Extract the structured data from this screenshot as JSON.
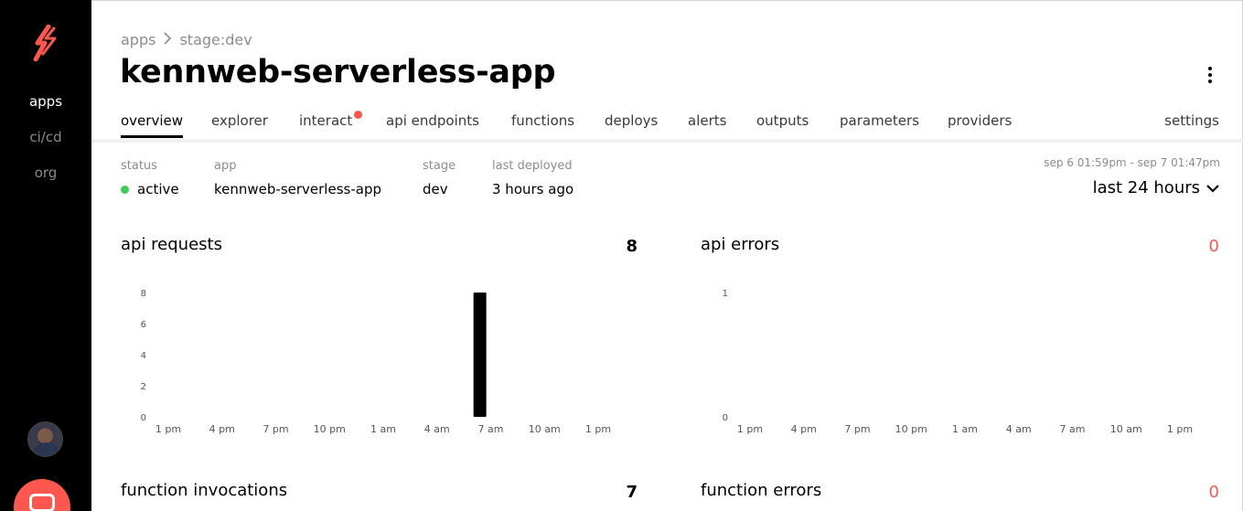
{
  "sidebar": {
    "items": [
      {
        "label": "apps",
        "active": true
      },
      {
        "label": "ci/cd",
        "active": false
      },
      {
        "label": "org",
        "active": false
      }
    ]
  },
  "breadcrumb": {
    "parent": "apps",
    "current": "stage:dev"
  },
  "title": "kennweb-serverless-app",
  "tabs": [
    {
      "label": "overview",
      "active": true
    },
    {
      "label": "explorer"
    },
    {
      "label": "interact",
      "badge": true
    },
    {
      "label": "api endpoints"
    },
    {
      "label": "functions"
    },
    {
      "label": "deploys"
    },
    {
      "label": "alerts"
    },
    {
      "label": "outputs"
    },
    {
      "label": "parameters"
    },
    {
      "label": "providers"
    },
    {
      "label": "settings"
    }
  ],
  "meta": {
    "status_label": "status",
    "status_value": "active",
    "app_label": "app",
    "app_value": "kennweb-serverless-app",
    "stage_label": "stage",
    "stage_value": "dev",
    "deployed_label": "last deployed",
    "deployed_value": "3 hours ago"
  },
  "time_range": {
    "label": "sep 6 01:59pm - sep 7 01:47pm",
    "selected": "last 24 hours"
  },
  "colors": {
    "accent": "#fd5750",
    "success": "#3ecb5b"
  },
  "cards": {
    "api_requests": {
      "title": "api requests",
      "total": "8"
    },
    "api_errors": {
      "title": "api errors",
      "total": "0"
    },
    "function_invocations": {
      "title": "function invocations",
      "total": "7"
    },
    "function_errors": {
      "title": "function errors",
      "total": "0"
    }
  },
  "chart_data": [
    {
      "type": "bar",
      "title": "api requests",
      "x_ticks": [
        "1 pm",
        "4 pm",
        "7 pm",
        "10 pm",
        "1 am",
        "4 am",
        "7 am",
        "10 am",
        "1 pm"
      ],
      "y_ticks": [
        "0",
        "2",
        "4",
        "6",
        "8"
      ],
      "ylim": [
        0,
        8
      ],
      "bars": [
        {
          "x_hours_from_start": 17.6,
          "value": 8
        }
      ]
    },
    {
      "type": "bar",
      "title": "api errors",
      "x_ticks": [
        "1 pm",
        "4 pm",
        "7 pm",
        "10 pm",
        "1 am",
        "4 am",
        "7 am",
        "10 am",
        "1 pm"
      ],
      "y_ticks": [
        "0",
        "1"
      ],
      "ylim": [
        0,
        1
      ],
      "bars": []
    }
  ]
}
